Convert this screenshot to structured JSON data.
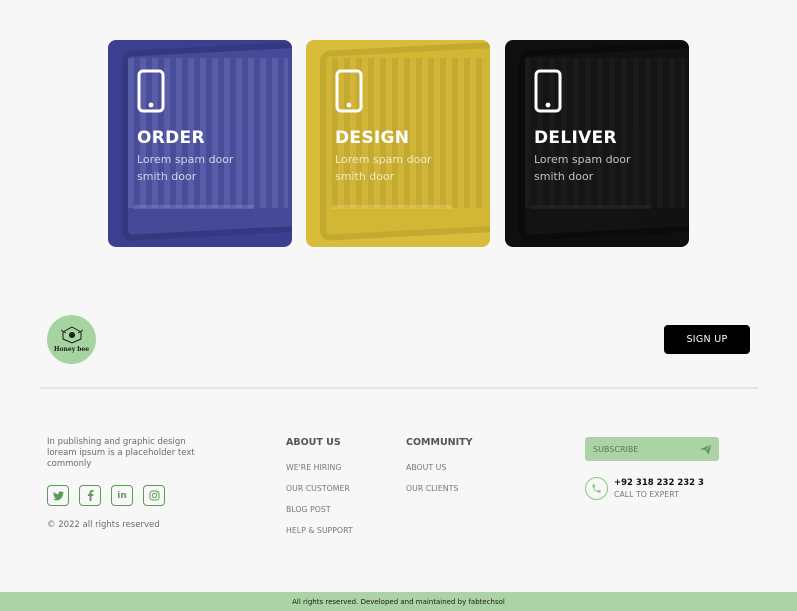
{
  "cards": [
    {
      "title": "ORDER",
      "text": "Lorem spam door smith door"
    },
    {
      "title": "DESIGN",
      "text": "Lorem spam door smith door"
    },
    {
      "title": "DELIVER",
      "text": "Lorem spam door smith door"
    }
  ],
  "logo": {
    "text": "Honey bee"
  },
  "signup_label": "SIGN UP",
  "footer": {
    "about_text": "In publishing and graphic design loream ipsum is a placeholder text commonly",
    "socials": [
      {
        "icon": "twitter-icon",
        "glyph": "t"
      },
      {
        "icon": "facebook-icon",
        "glyph": "f"
      },
      {
        "icon": "linkedin-icon",
        "glyph": "in"
      },
      {
        "icon": "instagram-icon",
        "glyph": "◎"
      }
    ],
    "copyright": "© 2022 all rights reserved",
    "about": {
      "heading": "ABOUT US",
      "links": [
        "WE'RE HIRING",
        "OUR CUSTOMER",
        "BLOG POST",
        "HELP & SUPPORT"
      ]
    },
    "community": {
      "heading": "COMMUNITY",
      "links": [
        "ABOUT US",
        "OUR CLIENTS"
      ]
    },
    "subscribe_placeholder": "SUBSCRIBE",
    "phone_number": "+92 318 232 232 3",
    "phone_label": "CALL TO EXPERT"
  },
  "bottom_bar": "All rights reserved. Developed and maintained by fabtechsol",
  "colors": {
    "order": "#3c3f8f",
    "design": "#d8bd3a",
    "deliver": "#0f0f0f",
    "accent_green": "#acd3a5",
    "social_green": "#5b9c55"
  }
}
